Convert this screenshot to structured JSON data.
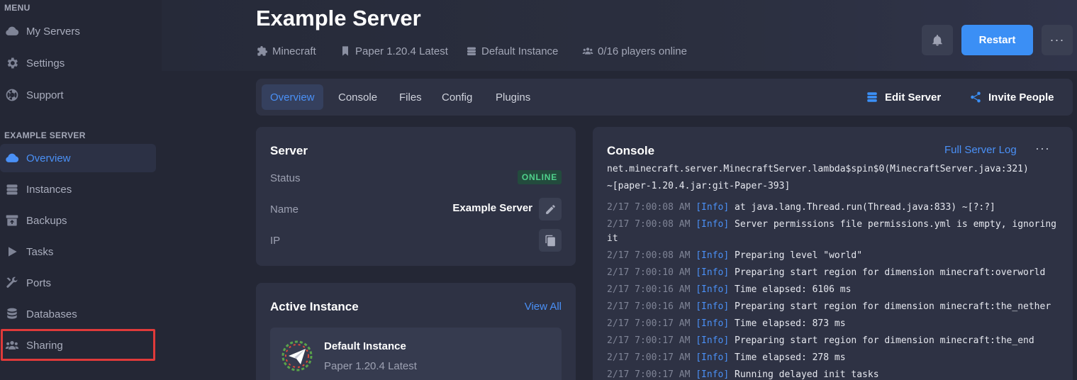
{
  "sidebar": {
    "menu_heading": "MENU",
    "menu_items": [
      {
        "label": "My Servers",
        "icon": "cloud-icon"
      },
      {
        "label": "Settings",
        "icon": "gear-icon"
      },
      {
        "label": "Support",
        "icon": "lifebuoy-icon"
      }
    ],
    "server_heading": "EXAMPLE SERVER",
    "server_items": [
      {
        "label": "Overview",
        "icon": "cloud-icon",
        "active": true
      },
      {
        "label": "Instances",
        "icon": "layers-icon"
      },
      {
        "label": "Backups",
        "icon": "archive-icon"
      },
      {
        "label": "Tasks",
        "icon": "play-icon"
      },
      {
        "label": "Ports",
        "icon": "tools-icon"
      },
      {
        "label": "Databases",
        "icon": "database-icon"
      },
      {
        "label": "Sharing",
        "icon": "users-icon"
      }
    ]
  },
  "header": {
    "title": "Example Server",
    "meta": {
      "game": "Minecraft",
      "version": "Paper 1.20.4 Latest",
      "instance": "Default Instance",
      "players": "0/16 players online"
    },
    "restart_label": "Restart",
    "more_label": "···"
  },
  "tabs": {
    "items": [
      "Overview",
      "Console",
      "Files",
      "Config",
      "Plugins"
    ],
    "active": "Overview",
    "edit_label": "Edit Server",
    "invite_label": "Invite People"
  },
  "server_card": {
    "title": "Server",
    "status_label": "Status",
    "status_value": "ONLINE",
    "name_label": "Name",
    "name_value": "Example Server",
    "ip_label": "IP"
  },
  "instance_card": {
    "title": "Active Instance",
    "view_all": "View All",
    "instance_name": "Default Instance",
    "instance_sub": "Paper 1.20.4 Latest"
  },
  "console": {
    "title": "Console",
    "full_log": "Full Server Log",
    "more_label": "···",
    "wrapped_top": [
      "net.minecraft.server.MinecraftServer.lambda$spin$0(MinecraftServer.java:321)",
      "~[paper-1.20.4.jar:git-Paper-393]"
    ],
    "lines": [
      {
        "ts": "2/17 7:00:08 AM",
        "level": "[Info]",
        "msg": "at java.lang.Thread.run(Thread.java:833) ~[?:?]"
      },
      {
        "ts": "2/17 7:00:08 AM",
        "level": "[Info]",
        "msg": "Server permissions file permissions.yml is empty, ignoring",
        "cont": "it"
      },
      {
        "ts": "2/17 7:00:08 AM",
        "level": "[Info]",
        "msg": "Preparing level \"world\""
      },
      {
        "ts": "2/17 7:00:10 AM",
        "level": "[Info]",
        "msg": "Preparing start region for dimension minecraft:overworld"
      },
      {
        "ts": "2/17 7:00:16 AM",
        "level": "[Info]",
        "msg": "Time elapsed: 6106 ms"
      },
      {
        "ts": "2/17 7:00:16 AM",
        "level": "[Info]",
        "msg": "Preparing start region for dimension minecraft:the_nether"
      },
      {
        "ts": "2/17 7:00:17 AM",
        "level": "[Info]",
        "msg": "Time elapsed: 873 ms"
      },
      {
        "ts": "2/17 7:00:17 AM",
        "level": "[Info]",
        "msg": "Preparing start region for dimension minecraft:the_end"
      },
      {
        "ts": "2/17 7:00:17 AM",
        "level": "[Info]",
        "msg": "Time elapsed: 278 ms"
      },
      {
        "ts": "2/17 7:00:17 AM",
        "level": "[Info]",
        "msg": "Running delayed init tasks"
      }
    ]
  },
  "colors": {
    "accent": "#3b8ff5",
    "online": "#4fd18b",
    "highlight": "#e03a3a"
  }
}
